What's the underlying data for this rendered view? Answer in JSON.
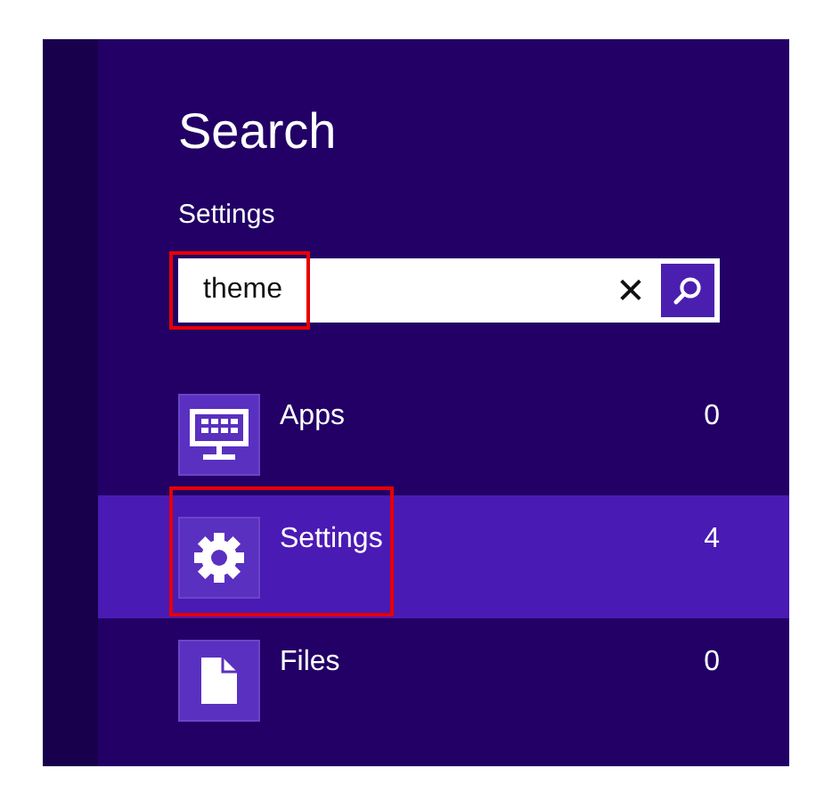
{
  "title": "Search",
  "scope": "Settings",
  "search": {
    "value": "theme",
    "highlighted": true,
    "clear": "✕"
  },
  "results": [
    {
      "kind": "apps",
      "label": "Apps",
      "count": "0",
      "selected": false,
      "highlighted": false
    },
    {
      "kind": "settings",
      "label": "Settings",
      "count": "4",
      "selected": true,
      "highlighted": true
    },
    {
      "kind": "files",
      "label": "Files",
      "count": "0",
      "selected": false,
      "highlighted": false
    }
  ]
}
